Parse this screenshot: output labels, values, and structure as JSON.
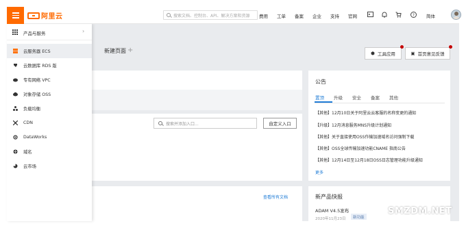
{
  "header": {
    "logo_text": "阿里云",
    "search_placeholder": "搜索文档、控制台、API、解决方案和资源",
    "nav": [
      "费用",
      "工单",
      "备案",
      "企业",
      "支持",
      "官网"
    ],
    "language": "简体",
    "icons": [
      "terminal-icon",
      "bell-icon",
      "cart-icon",
      "help-icon"
    ]
  },
  "drawer": {
    "header_label": "产品与服务",
    "items": [
      {
        "label": "云服务器 ECS",
        "icon": "ecs-icon",
        "active": true
      },
      {
        "label": "云数据库 RDS 版",
        "icon": "rds-icon",
        "active": false
      },
      {
        "label": "专有网络 VPC",
        "icon": "vpc-icon",
        "active": false
      },
      {
        "label": "对象存储 OSS",
        "icon": "oss-icon",
        "active": false
      },
      {
        "label": "负载均衡",
        "icon": "slb-icon",
        "active": false
      },
      {
        "label": "CDN",
        "icon": "cdn-icon",
        "active": false
      },
      {
        "label": "DataWorks",
        "icon": "dataworks-icon",
        "active": false
      },
      {
        "label": "域名",
        "icon": "domain-icon",
        "active": false
      },
      {
        "label": "云市场",
        "icon": "market-icon",
        "active": false
      }
    ]
  },
  "page": {
    "tab_new": "新建页面",
    "btn_tools": "工具应用",
    "btn_feedback": "首页意见反馈",
    "search_placeholder": "搜索并添加入口...",
    "custom_entry": "自定义入口",
    "doc_link": "查看所有文档"
  },
  "announcements": {
    "title": "公告",
    "tabs": [
      "置顶",
      "升级",
      "安全",
      "备案",
      "其他"
    ],
    "active_tab": "置顶",
    "items": [
      "【其他】12月10日关于阿里云云客服的名称变更的通知",
      "【升级】12月消息服务MNS升级计划通知",
      "【其他】关于直接使用OSS作输加速域名访问强制下载",
      "【其他】OSS全球传输加速功能CNAME 指南公告",
      "【其他】12月14日至12月18日OSS日志管理功能升级通知"
    ],
    "more": "更多"
  },
  "new_products": {
    "title": "新产品快报",
    "name": "ADAM V4.5发布",
    "date": "2020年11月23日",
    "badge": "新功能"
  },
  "watermark": "SMZDM.NET",
  "colors": {
    "accent": "#ff6a00",
    "link": "#1f7cd6"
  }
}
